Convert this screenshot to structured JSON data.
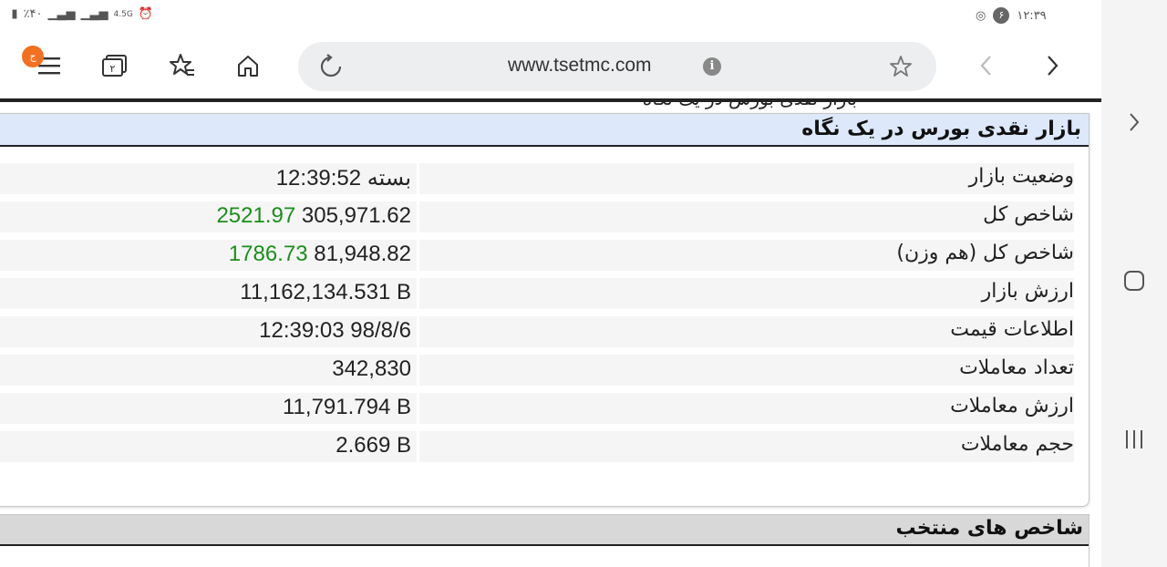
{
  "status_bar": {
    "battery_text": "٪۴۰",
    "network_label": "4.5G",
    "time": "۱۲:۳۹",
    "notification_count": "۶"
  },
  "toolbar": {
    "menu_badge": "ج",
    "tabs_count": "۲",
    "url": "www.tsetmc.com"
  },
  "page": {
    "peek_title": "بازار نقدی بورس در یک نگاه",
    "panel_title": "بازار نقدی بورس در یک نگاه",
    "rows": [
      {
        "label": "وضعیت بازار",
        "value": "12:39:52",
        "status": "بسته"
      },
      {
        "label": "شاخص کل",
        "value": "305,971.62",
        "change": "2521.97"
      },
      {
        "label": "شاخص کل (هم وزن)",
        "value": "81,948.82",
        "change": "1786.73"
      },
      {
        "label": "ارزش بازار",
        "value": "11,162,134.531 B"
      },
      {
        "label": "اطلاعات قیمت",
        "value": "12:39:03 98/8/6"
      },
      {
        "label": "تعداد معاملات",
        "value": "342,830"
      },
      {
        "label": "ارزش معاملات",
        "value": "11,791.794 B"
      },
      {
        "label": "حجم معاملات",
        "value": "2.669 B"
      }
    ],
    "panel2_title": "شاخص های منتخب"
  },
  "colors": {
    "positive_change": "#1a8f1a",
    "panel_header": "#dde9fb",
    "menu_badge": "#f37021"
  }
}
